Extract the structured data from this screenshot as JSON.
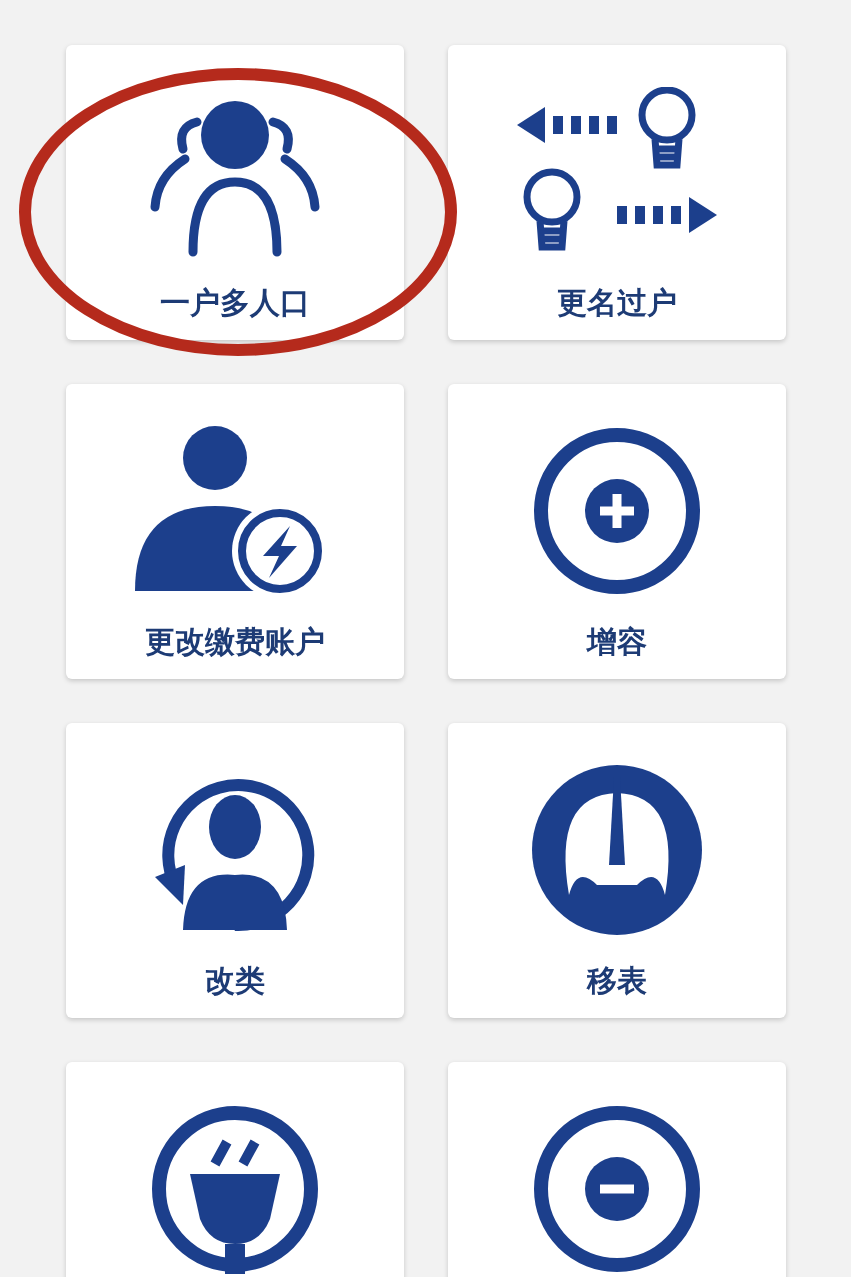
{
  "services": [
    {
      "kind": "family",
      "label": "一户多人口",
      "circled": true
    },
    {
      "kind": "rename",
      "label": "更名过户",
      "circled": false
    },
    {
      "kind": "payer",
      "label": "更改缴费账户",
      "circled": false
    },
    {
      "kind": "capacity-add",
      "label": "增容",
      "circled": false
    },
    {
      "kind": "reclass",
      "label": "改类",
      "circled": false
    },
    {
      "kind": "meter-move",
      "label": "移表",
      "circled": false
    },
    {
      "kind": "plug",
      "circled": false
    },
    {
      "kind": "capacity-reduce",
      "circled": false
    }
  ]
}
